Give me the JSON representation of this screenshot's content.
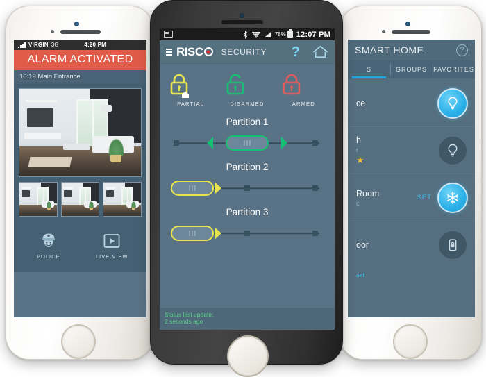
{
  "scene": {
    "description": "Three smartphones showing RISCO security and smart-home app screens"
  },
  "left_phone": {
    "status_bar": {
      "carrier": "VIRGIN",
      "network": "3G",
      "time": "4:20 PM"
    },
    "alarm_banner": "ALARM ACTIVATED",
    "alarm_detail": "16:19 Main Entrance",
    "camera": {
      "main_label": "live-camera-view",
      "thumbnail_count": 3
    },
    "actions": [
      {
        "label": "POLICE",
        "icon": "police-officer-icon"
      },
      {
        "label": "LIVE VIEW",
        "icon": "play-button-icon"
      }
    ]
  },
  "center_phone": {
    "status_bar": {
      "battery": "78%",
      "time": "12:07 PM",
      "icons": [
        "screenshot-icon",
        "bluetooth-icon",
        "wifi-icon",
        "signal-icon",
        "battery-icon"
      ]
    },
    "app_bar": {
      "brand": "RISC",
      "brand_suffix": "SECURITY",
      "menu_icon": "hamburger-icon",
      "help_icon": "question-mark-icon",
      "home_icon": "home-icon",
      "brand_dot_color": "#d92b34"
    },
    "modes": [
      {
        "label": "PARTIAL",
        "icon": "lock-house-icon",
        "color": "#e8e44f"
      },
      {
        "label": "DISARMED",
        "icon": "unlocked-padlock-icon",
        "color": "#16c172"
      },
      {
        "label": "ARMED",
        "icon": "locked-padlock-icon",
        "color": "#e05c5c"
      }
    ],
    "partitions": [
      {
        "title": "Partition 1",
        "state": "disarmed",
        "handle_position": "center",
        "accent": "#16c172"
      },
      {
        "title": "Partition 2",
        "state": "partial",
        "handle_position": "left",
        "accent": "#e8e44f"
      },
      {
        "title": "Partition 3",
        "state": "partial",
        "handle_position": "left",
        "accent": "#e8e44f"
      }
    ],
    "footer": {
      "line1": "Status last update:",
      "line2": "2 seconds ago",
      "color": "#5fd18a"
    }
  },
  "right_phone": {
    "title": "SMART HOME",
    "help_icon": "question-mark-circle-icon",
    "tabs": [
      {
        "label": "S",
        "active": true
      },
      {
        "label": "GROUPS",
        "active": false
      },
      {
        "label": "FAVORITES",
        "active": false
      }
    ],
    "rows": [
      {
        "name": "ce",
        "sub": "",
        "starred": false,
        "set": "",
        "icon": "light-bulb-icon",
        "state": "on"
      },
      {
        "name": "h",
        "sub": "r",
        "starred": true,
        "set": "",
        "icon": "light-bulb-icon",
        "state": "off"
      },
      {
        "name": "Room",
        "sub": "c",
        "starred": false,
        "set": "SET",
        "icon": "snowflake-icon",
        "state": "on"
      },
      {
        "name": "oor",
        "sub": "",
        "starred": false,
        "set": "",
        "icon": "door-lock-icon",
        "state": "off"
      }
    ],
    "reset_link": "set"
  }
}
